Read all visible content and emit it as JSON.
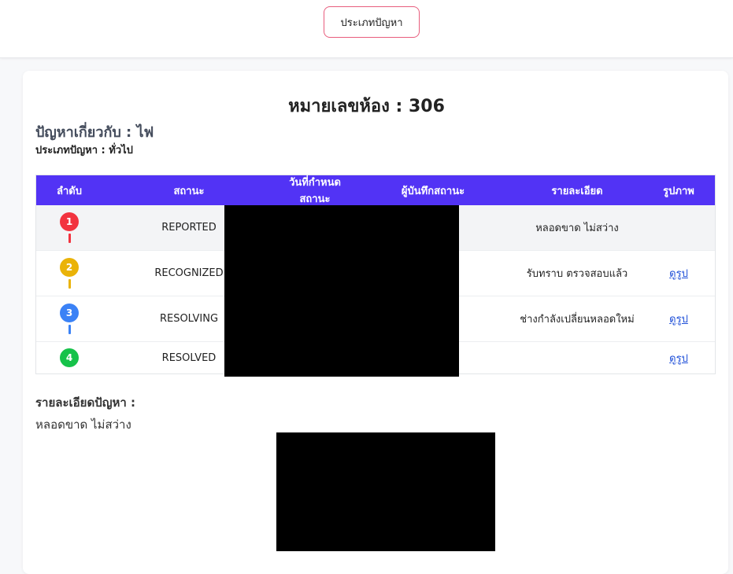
{
  "header": {
    "type_button_label": "ประเภทปัญหา"
  },
  "room": {
    "title": "หมายเลขห้อง : 306"
  },
  "issue": {
    "about_label": "ปัญหาเกี่ยวกับ : ไฟ",
    "type_label": "ประเภทปัญหา : ทั่วไป"
  },
  "table": {
    "headers": [
      "ลำดับ",
      "สถานะ",
      "วันที่กำหนดสถานะ",
      "ผู้บันทึกสถานะ",
      "รายละเอียด",
      "รูปภาพ"
    ],
    "rows": [
      {
        "step": "1",
        "status": "REPORTED",
        "detail": "หลอดขาด ไม่สว่าง",
        "image_link": ""
      },
      {
        "step": "2",
        "status": "RECOGNIZED",
        "detail": "รับทราบ ตรวจสอบแล้ว",
        "image_link": "ดูรูป"
      },
      {
        "step": "3",
        "status": "RESOLVING",
        "detail": "ช่างกำลังเปลี่ยนหลอดใหม่",
        "image_link": "ดูรูป"
      },
      {
        "step": "4",
        "status": "RESOLVED",
        "detail": "",
        "image_link": "ดูรูป"
      }
    ],
    "step_colors": [
      "#f2333f",
      "#eab308",
      "#3b82f6",
      "#16c24a"
    ]
  },
  "details": {
    "label": "รายละเอียดปัญหา :",
    "text": "หลอดขาด ไม่สว่าง"
  },
  "colors": {
    "header_bg": "#5233f5",
    "button_border": "#e85d7d",
    "link": "#1d4ed8"
  }
}
